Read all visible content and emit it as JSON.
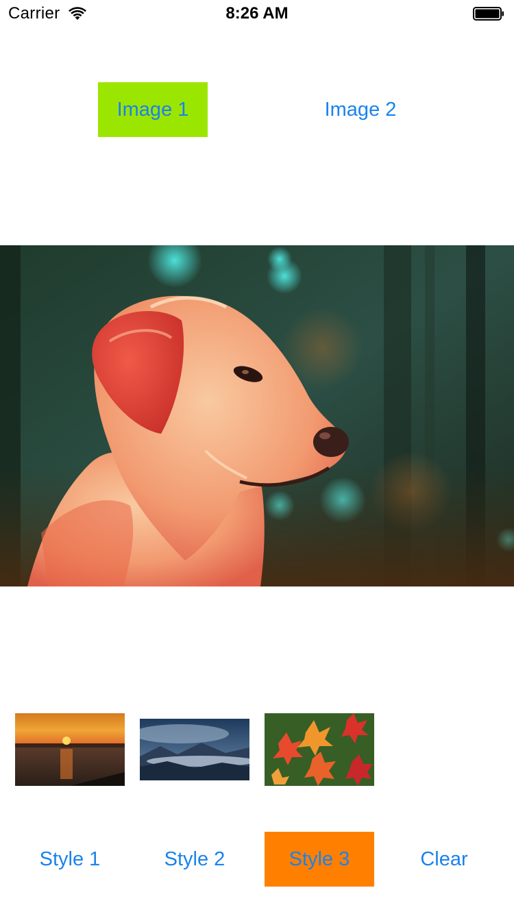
{
  "status_bar": {
    "carrier": "Carrier",
    "time": "8:26 AM",
    "wifi_icon": "wifi-icon",
    "battery_icon": "battery-full-icon"
  },
  "image_tabs": {
    "items": [
      {
        "label": "Image 1",
        "selected": true
      },
      {
        "label": "Image 2",
        "selected": false
      }
    ],
    "selected_color": "#9be600"
  },
  "main_image": {
    "subject": "golden retriever dog portrait with filter applied"
  },
  "thumbnails": [
    {
      "subject": "sunset over water"
    },
    {
      "subject": "misty mountains under cloudy sky"
    },
    {
      "subject": "red and orange maple leaves on grass"
    }
  ],
  "style_buttons": {
    "items": [
      {
        "label": "Style 1",
        "selected": false
      },
      {
        "label": "Style 2",
        "selected": false
      },
      {
        "label": "Style 3",
        "selected": true
      },
      {
        "label": "Clear",
        "selected": false
      }
    ],
    "selected_color": "#ff8000"
  },
  "colors": {
    "tint": "#1a82ed",
    "background": "#ffffff"
  }
}
